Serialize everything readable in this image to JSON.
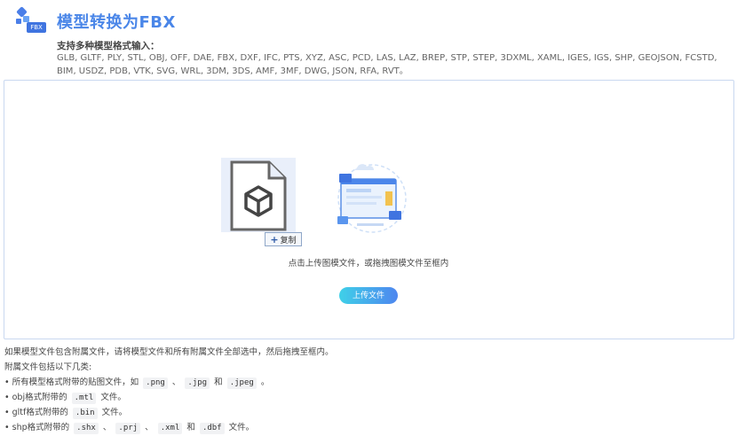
{
  "header": {
    "logo_badge": "FBX",
    "title": "模型转换为FBX"
  },
  "support": {
    "label": "支持多种模型格式输入：",
    "formats": "GLB, GLTF, PLY, STL, OBJ, OFF, DAE, FBX, DXF, IFC, PTS, XYZ, ASC, PCD, LAS, LAZ, BREP, STP, STEP, 3DXML, XAML, IGES, IGS, SHP, GEOJSON, FCSTD, BIM, USDZ, PDB, VTK, SVG, WRL, 3DM, 3DS, AMF, 3MF, DWG, JSON, RFA, RVT。"
  },
  "dropzone": {
    "copy_label": "复制",
    "hint": "点击上传图模文件，或拖拽图模文件至框内",
    "upload_label": "上传文件"
  },
  "notes": {
    "intro": "如果模型文件包含附属文件，请将模型文件和所有附属文件全部选中，然后拖拽至框内。",
    "types_label": "附属文件包括以下几类:",
    "line1_pre": "• 所有模型格式附带的贴图文件，如",
    "line1_c1": ".png",
    "line1_sep1": "、",
    "line1_c2": ".jpg",
    "line1_sep2": "和",
    "line1_c3": ".jpeg",
    "line1_end": "。",
    "line2_pre": "• obj格式附带的",
    "line2_c1": ".mtl",
    "line2_end": "文件。",
    "line3_pre": "• gltf格式附带的",
    "line3_c1": ".bin",
    "line3_end": "文件。",
    "line4_pre": "• shp格式附带的",
    "line4_c1": ".shx",
    "line4_sep1": "、",
    "line4_c2": ".prj",
    "line4_sep2": "、",
    "line4_c3": ".xml",
    "line4_sep3": "和",
    "line4_c4": ".dbf",
    "line4_end": "文件。"
  }
}
